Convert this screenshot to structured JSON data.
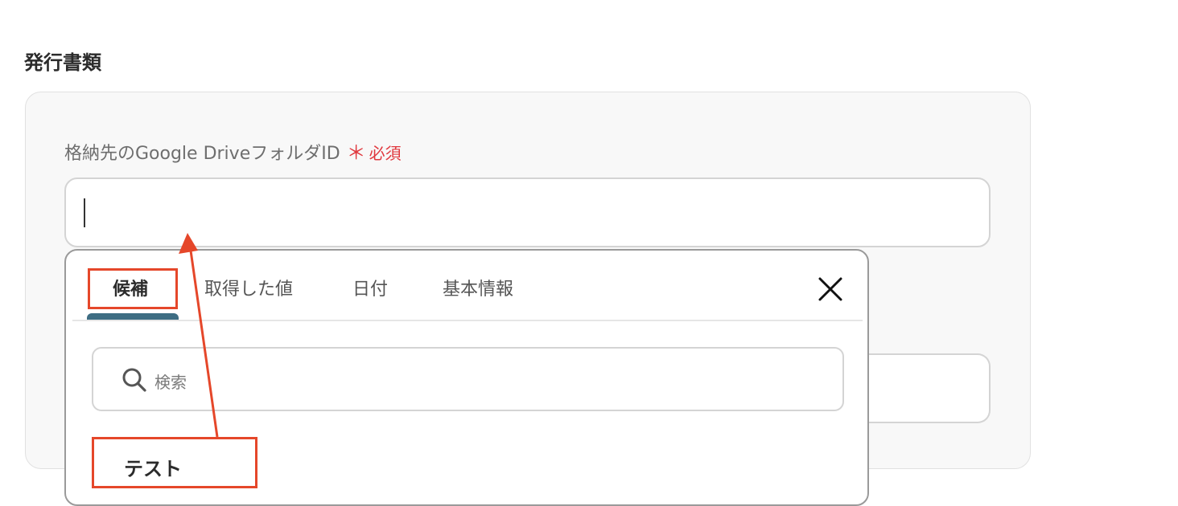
{
  "section": {
    "title": "発行書類"
  },
  "field": {
    "label": "格納先のGoogle Driveフォルダ",
    "label_suffix": "ID",
    "required_mark": "＊",
    "required_text": "必須",
    "value": ""
  },
  "popup": {
    "tabs": [
      {
        "label": "候補",
        "active": true
      },
      {
        "label": "取得した値",
        "active": false
      },
      {
        "label": "日付",
        "active": false
      },
      {
        "label": "基本情報",
        "active": false
      }
    ],
    "search_placeholder": "検索",
    "items": [
      {
        "label": "テスト"
      }
    ]
  },
  "colors": {
    "accent": "#3e6d83",
    "required": "#e0383e",
    "annotation": "#e5472a",
    "card_bg": "#f8f8f8"
  },
  "icons": {
    "close": "close-icon",
    "search": "search-icon"
  }
}
